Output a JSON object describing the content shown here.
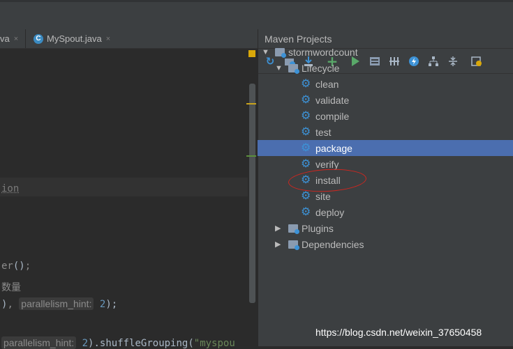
{
  "editor": {
    "tabs": [
      {
        "label": "va",
        "close": "×"
      },
      {
        "label": "MySpout.java",
        "close": "×",
        "icon": "C"
      }
    ],
    "code_lines": {
      "l1": "ion",
      "l2_a": "er",
      "l2_b": "()",
      "l2_c": ";",
      "l3": "数量",
      "l4_a": ")",
      "l4_b": ", ",
      "l4_hint": "parallelism_hint:",
      "l4_num": "2",
      "l4_end": ");",
      "l5_hint": "parallelism_hint:",
      "l5_num": "2",
      "l5_a": ").shuffleGrouping(",
      "l5_str": "\"myspou"
    }
  },
  "maven": {
    "title": "Maven Projects",
    "toolbar": [
      "refresh-icon",
      "generate-sources-icon",
      "download-icon",
      "add-icon",
      "run-icon",
      "execute-goal-icon",
      "toggle-offline-icon",
      "skip-tests-icon",
      "show-dependencies-icon",
      "collapse-all-icon",
      "settings-icon"
    ],
    "tree": {
      "root": {
        "label": "stormwordcount",
        "arrow": "▼"
      },
      "lifecycle": {
        "label": "Lifecycle",
        "arrow": "▼"
      },
      "goals": [
        "clean",
        "validate",
        "compile",
        "test",
        "package",
        "verify",
        "install",
        "site",
        "deploy"
      ],
      "selected": "package",
      "plugins": {
        "label": "Plugins",
        "arrow": "▶"
      },
      "dependencies": {
        "label": "Dependencies",
        "arrow": "▶"
      }
    }
  },
  "watermark": "https://blog.csdn.net/weixin_37650458",
  "colors": {
    "selection": "#4b6eaf",
    "gear": "#3d92d6",
    "annotation": "#d2261f"
  }
}
